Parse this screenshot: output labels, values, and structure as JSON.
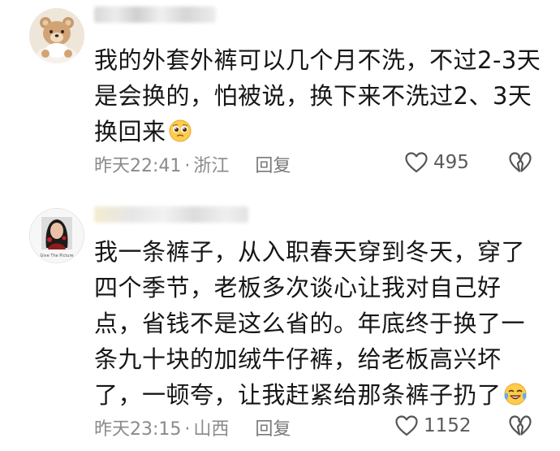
{
  "comments": [
    {
      "avatar": "teddy-bear-avatar",
      "text": "我的外套外裤可以几个月不洗，不过2-3天是会换的，怕被说，换下来不洗过2、3天换回来",
      "emoji": "pleading-face-emoji",
      "time": "昨天22:41",
      "separator": "·",
      "location": "浙江",
      "reply_label": "回复",
      "like_icon": "heart-outline-icon",
      "likes": "495",
      "dislike_icon": "broken-heart-icon"
    },
    {
      "avatar": "girl-portrait-avatar",
      "avatar_caption": "Give The Picture",
      "text": "我一条裤子，从入职春天穿到冬天，穿了四个季节，老板多次谈心让我对自己好点，省钱不是这么省的。年底终于换了一条九十块的加绒牛仔裤，给老板高兴坏了，一顿夸，让我赶紧给那条裤子扔了",
      "emoji": "tears-of-joy-emoji",
      "time": "昨天23:15",
      "separator": "·",
      "location": "山西",
      "reply_label": "回复",
      "like_icon": "heart-outline-icon",
      "likes": "1152",
      "dislike_icon": "broken-heart-icon"
    }
  ]
}
